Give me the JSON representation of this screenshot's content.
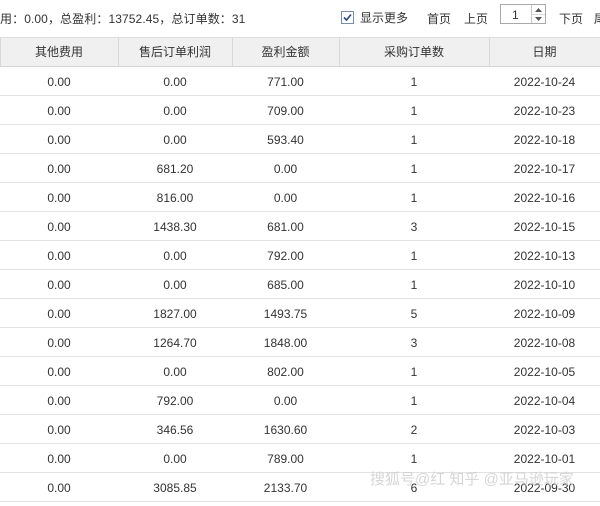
{
  "summary": {
    "text": "用：0.00，总盈利：13752.45，总订单数：31"
  },
  "pager": {
    "show_more_label": "显示更多",
    "show_more_checked": true,
    "first_label": "首页",
    "prev_label": "上页",
    "page_value": "1",
    "next_label": "下页",
    "last_label_partial": "尾"
  },
  "table": {
    "headers": [
      "其他费用",
      "售后订单利润",
      "盈利金额",
      "采购订单数",
      "日期"
    ],
    "rows": [
      [
        "0.00",
        "0.00",
        "771.00",
        "1",
        "2022-10-24"
      ],
      [
        "0.00",
        "0.00",
        "709.00",
        "1",
        "2022-10-23"
      ],
      [
        "0.00",
        "0.00",
        "593.40",
        "1",
        "2022-10-18"
      ],
      [
        "0.00",
        "681.20",
        "0.00",
        "1",
        "2022-10-17"
      ],
      [
        "0.00",
        "816.00",
        "0.00",
        "1",
        "2022-10-16"
      ],
      [
        "0.00",
        "1438.30",
        "681.00",
        "3",
        "2022-10-15"
      ],
      [
        "0.00",
        "0.00",
        "792.00",
        "1",
        "2022-10-13"
      ],
      [
        "0.00",
        "0.00",
        "685.00",
        "1",
        "2022-10-10"
      ],
      [
        "0.00",
        "1827.00",
        "1493.75",
        "5",
        "2022-10-09"
      ],
      [
        "0.00",
        "1264.70",
        "1848.00",
        "3",
        "2022-10-08"
      ],
      [
        "0.00",
        "0.00",
        "802.00",
        "1",
        "2022-10-05"
      ],
      [
        "0.00",
        "792.00",
        "0.00",
        "1",
        "2022-10-04"
      ],
      [
        "0.00",
        "346.56",
        "1630.60",
        "2",
        "2022-10-03"
      ],
      [
        "0.00",
        "0.00",
        "789.00",
        "1",
        "2022-10-01"
      ],
      [
        "0.00",
        "3085.85",
        "2133.70",
        "6",
        "2022-09-30"
      ]
    ]
  },
  "watermark": {
    "text": "搜狐号@红 知乎 @亚马逊玩家"
  }
}
